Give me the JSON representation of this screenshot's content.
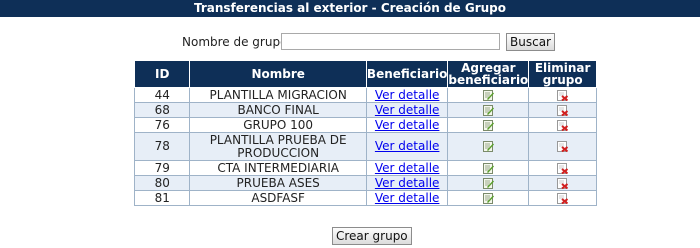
{
  "header": {
    "title": "Transferencias al exterior - Creación de Grupo"
  },
  "search": {
    "label": "Nombre de grupo:",
    "value": "",
    "placeholder": "",
    "button_label": "Buscar"
  },
  "table": {
    "columns": {
      "id": "ID",
      "nombre": "Nombre",
      "beneficiario": "Beneficiario",
      "agregar_line1": "Agregar",
      "agregar_line2": "beneficiario",
      "eliminar_line1": "Eliminar",
      "eliminar_line2": "grupo"
    },
    "rows": [
      {
        "id": "44",
        "nombre": "PLANTILLA MIGRACION",
        "link": "Ver detalle"
      },
      {
        "id": "68",
        "nombre": "BANCO FINAL",
        "link": "Ver detalle"
      },
      {
        "id": "76",
        "nombre": "GRUPO 100",
        "link": "Ver detalle"
      },
      {
        "id": "78",
        "nombre": "PLANTILLA PRUEBA DE PRODUCCION",
        "link": "Ver detalle"
      },
      {
        "id": "79",
        "nombre": "CTA INTERMEDIARIA",
        "link": "Ver detalle"
      },
      {
        "id": "80",
        "nombre": "PRUEBA ASES",
        "link": "Ver detalle"
      },
      {
        "id": "81",
        "nombre": "ASDFASF",
        "link": "Ver detalle"
      }
    ]
  },
  "icons": {
    "add": "edit-note-icon",
    "delete": "delete-document-icon"
  },
  "footer": {
    "create_button_label": "Crear grupo"
  }
}
